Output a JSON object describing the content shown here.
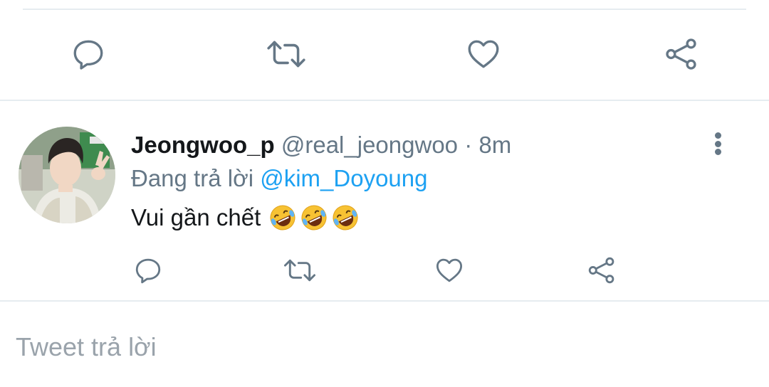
{
  "top_actions": {
    "reply_icon": "reply-icon",
    "retweet_icon": "retweet-icon",
    "like_icon": "heart-icon",
    "share_icon": "share-icon"
  },
  "tweet": {
    "display_name": "Jeongwoo_p",
    "handle": "@real_jeongwoo",
    "separator": "·",
    "time": "8m",
    "reply_prefix": "Đang trả lời",
    "reply_mention": "@kim_Doyoung",
    "text": "Vui gần chết",
    "emoji": [
      "🤣",
      "🤣",
      "🤣"
    ],
    "more_icon": "more-vertical-icon"
  },
  "reply_box": {
    "placeholder": "Tweet trả lời"
  },
  "colors": {
    "accent": "#1da1f2",
    "icon": "#657786",
    "divider": "#e6ecf0",
    "text": "#14171a",
    "placeholder": "#9aa3ab"
  }
}
